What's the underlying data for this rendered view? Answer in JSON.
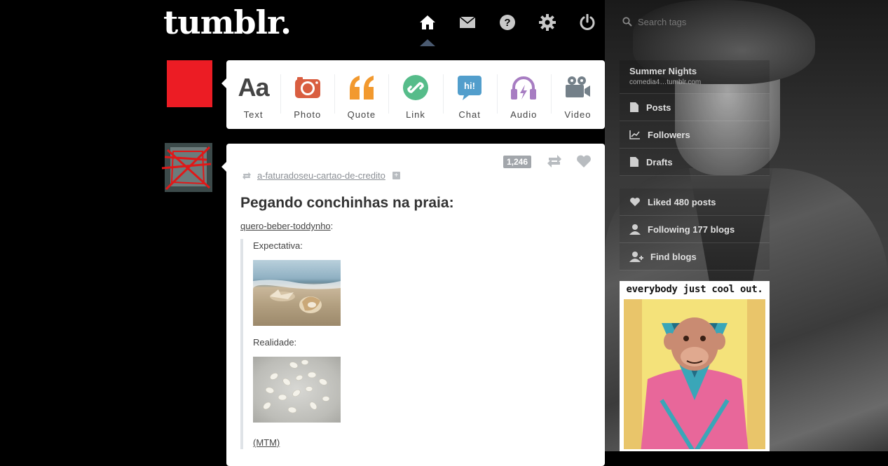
{
  "brand": {
    "logo": "tumblr."
  },
  "nav": {
    "items": [
      {
        "name": "home",
        "icon": "home-icon"
      },
      {
        "name": "messages",
        "icon": "mail-icon"
      },
      {
        "name": "help",
        "icon": "help-icon"
      },
      {
        "name": "settings",
        "icon": "gear-icon"
      },
      {
        "name": "logout",
        "icon": "power-icon"
      }
    ],
    "search_placeholder": "Search tags"
  },
  "post_types": [
    {
      "label": "Text",
      "icon": "text-icon",
      "color": "#444444"
    },
    {
      "label": "Photo",
      "icon": "camera-icon",
      "color": "#d95e40"
    },
    {
      "label": "Quote",
      "icon": "quote-icon",
      "color": "#f2992e"
    },
    {
      "label": "Link",
      "icon": "link-icon",
      "color": "#56bc8a"
    },
    {
      "label": "Chat",
      "icon": "chat-icon",
      "color": "#529ecc"
    },
    {
      "label": "Audio",
      "icon": "audio-icon",
      "color": "#a77dc2"
    },
    {
      "label": "Video",
      "icon": "video-icon",
      "color": "#748089"
    }
  ],
  "post": {
    "notes": "1,246",
    "reblogged_from": "a-faturadoseu-cartao-de-credito",
    "title": "Pegando conchinhas na praia:",
    "author": "quero-beber-toddynho",
    "author_suffix": ":",
    "label_expectation": "Expectativa:",
    "label_reality": "Realidade:",
    "footer_link": "(MTM)"
  },
  "sidebar": {
    "blog_title": "Summer Nights",
    "blog_url": "comedia4…tumblr.com",
    "items": [
      {
        "label": "Posts",
        "icon": "document-icon"
      },
      {
        "label": "Followers",
        "icon": "chart-icon"
      },
      {
        "label": "Drafts",
        "icon": "document-icon"
      }
    ],
    "items2": [
      {
        "label": "Liked 480 posts",
        "icon": "heart-icon"
      },
      {
        "label": "Following 177 blogs",
        "icon": "person-icon"
      },
      {
        "label": "Find blogs",
        "icon": "add-person-icon"
      }
    ],
    "ad_caption": "everybody just cool out."
  },
  "colors": {
    "accent_red": "#ec1c24",
    "nav_caret": "#4a5a70"
  }
}
